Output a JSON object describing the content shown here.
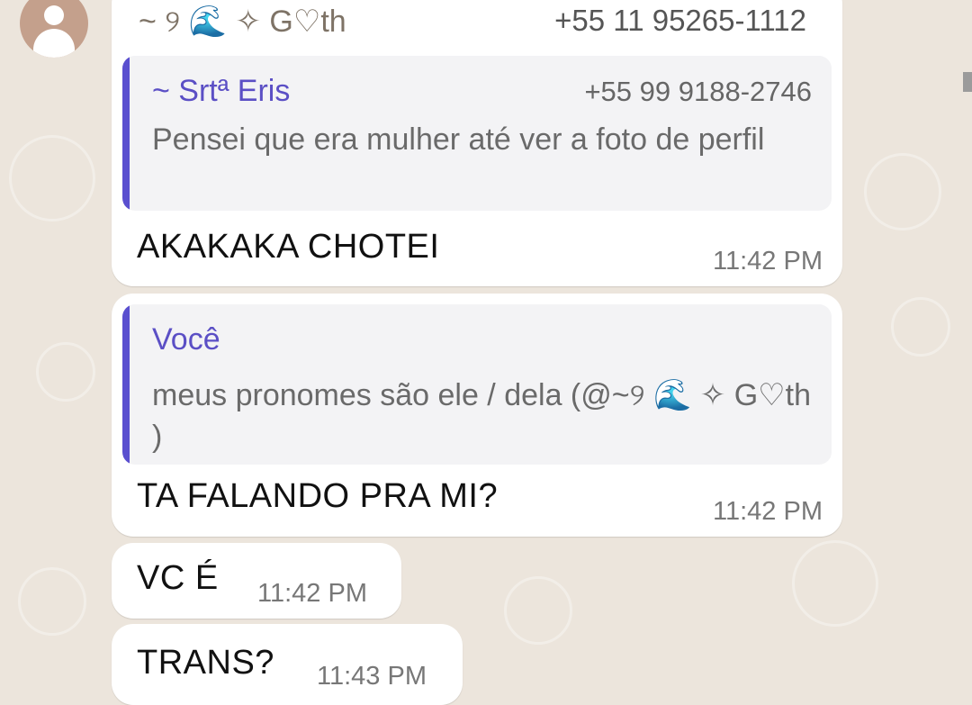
{
  "messages": [
    {
      "sender_name": "~ ୨ 🌊 ✧ G♡th",
      "sender_phone": "+55 11 95265-1112",
      "quote_name": "~ Srtª Eris",
      "quote_phone": "+55 99 9188-2746",
      "quote_text": "Pensei que era mulher até ver a foto de perfil",
      "text": "AKAKAKA CHOTEI",
      "time": "11:42 PM"
    },
    {
      "quote_name": "Você",
      "quote_text": "meus pronomes são ele / dela (@~୨ 🌊 ✧ G♡th )",
      "text": "TA FALANDO PRA MI?",
      "time": "11:42 PM"
    },
    {
      "text": "VC É",
      "time": "11:42 PM"
    },
    {
      "text": "TRANS?",
      "time": "11:43 PM"
    }
  ],
  "icons": {
    "avatar": "default-avatar-icon"
  },
  "colors": {
    "background": "#ece5dc",
    "bubble": "#ffffff",
    "quote_bar": "#5a4fcf",
    "quote_name": "#5b4fc5"
  }
}
